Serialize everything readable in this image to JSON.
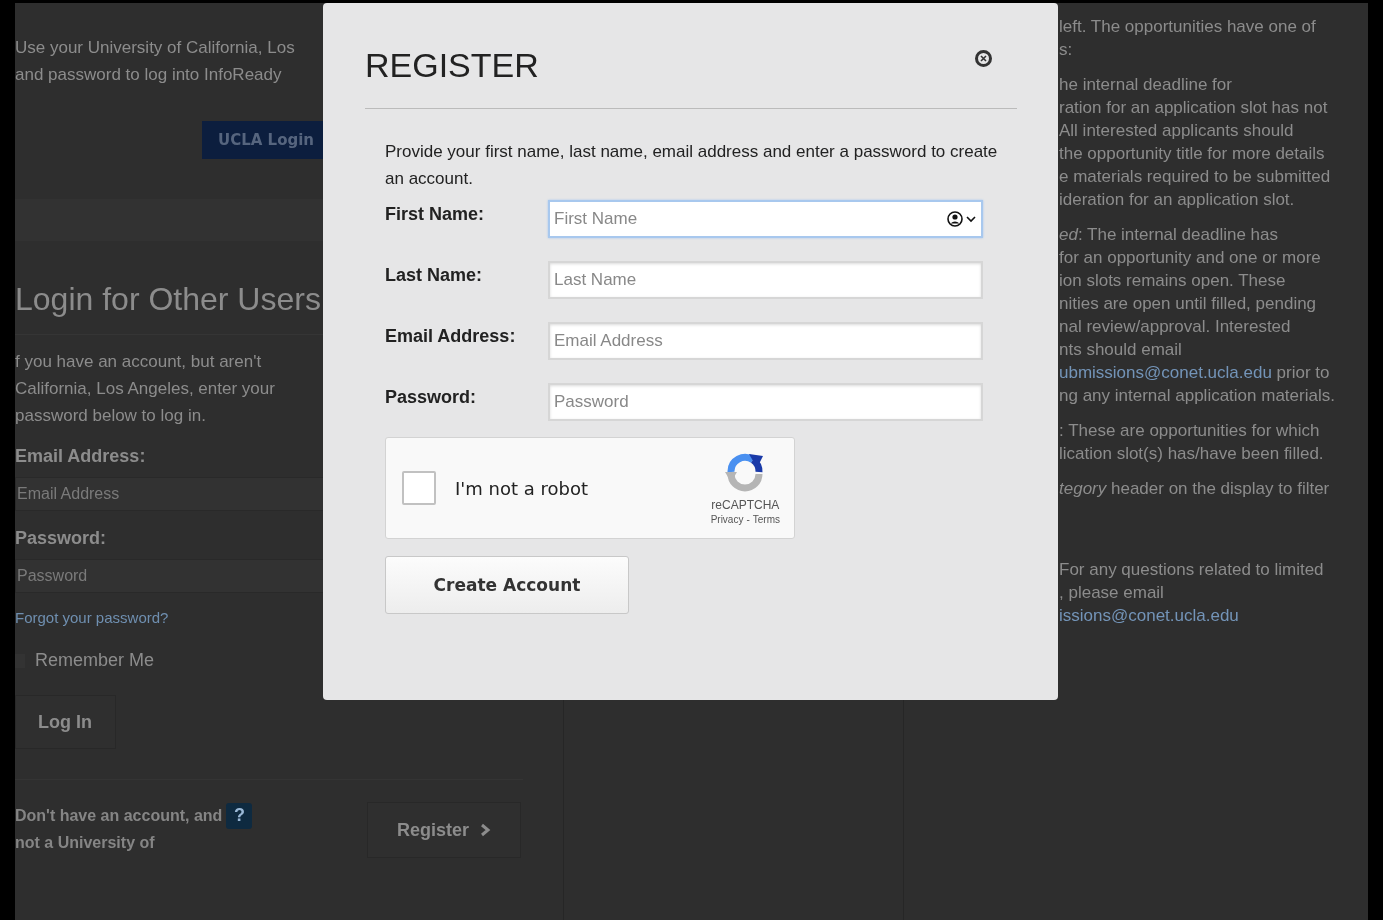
{
  "background_page": {
    "left_column": {
      "intro_lines": [
        "Use your University of California, Los",
        "and password to log into InfoReady"
      ],
      "sso_button": "UCLA Login",
      "heading": "Login for Other Users",
      "para_lines": [
        "f you have an account, but aren't",
        "California, Los Angeles, enter your",
        "password below to log in."
      ],
      "email_label": "Email Address:",
      "email_placeholder": "Email Address",
      "password_label": "Password:",
      "password_placeholder": "Password",
      "forgot_link": "Forgot your password?",
      "remember": {
        "label": "Remember Me",
        "checked": false
      },
      "login_button": "Log In",
      "register_prompt_lines": [
        "Don't have an account, and",
        "not a University of"
      ],
      "help_badge": "?",
      "register_button": "Register"
    },
    "right_column": {
      "paragraphs": [
        [
          {
            "text": "left. The opportunities have one of"
          },
          {
            "text": "s:"
          }
        ],
        [
          {
            "text": "he internal deadline for"
          },
          {
            "text": "ration for an application slot has not"
          },
          {
            "text": "All interested applicants should"
          },
          {
            "text": "the opportunity title for more details"
          },
          {
            "text": "e materials required to be submitted"
          },
          {
            "text": "ideration for an application slot."
          }
        ],
        [
          {
            "text": "*ed*: The internal deadline has"
          },
          {
            "text": "for an opportunity and one or more"
          },
          {
            "text": "ion slots remains open. These"
          },
          {
            "text": "nities are open until filled, pending"
          },
          {
            "text": "nal review/approval. Interested"
          },
          {
            "text": "nts should email"
          },
          {
            "link": "ubmissions@conet.ucla.edu",
            "text": " prior to"
          },
          {
            "text": "ng any internal application materials."
          }
        ],
        [
          {
            "text": ": These are opportunities for which"
          },
          {
            "text": "lication slot(s) has/have been filled."
          }
        ],
        [
          {
            "text": "*tegory* header on the display to filter"
          }
        ],
        [
          {
            "text": "For any questions related to limited"
          },
          {
            "text": ", please email"
          },
          {
            "link": "issions@conet.ucla.edu"
          }
        ]
      ]
    }
  },
  "modal": {
    "title": "REGISTER",
    "intro": "Provide your first name, last name, email address and enter a password to create an account.",
    "fields": [
      {
        "label": "First Name:",
        "placeholder": "First Name",
        "focused": true
      },
      {
        "label": "Last Name:",
        "placeholder": "Last Name",
        "focused": false
      },
      {
        "label": "Email Address:",
        "placeholder": "Email Address",
        "focused": false
      },
      {
        "label": "Password:",
        "placeholder": "Password",
        "focused": false
      }
    ],
    "captcha": {
      "label": "I'm not a robot",
      "checked": false,
      "brand": "reCAPTCHA",
      "privacy": "Privacy",
      "separator": "-",
      "terms": "Terms"
    },
    "submit_button": "Create Account"
  }
}
